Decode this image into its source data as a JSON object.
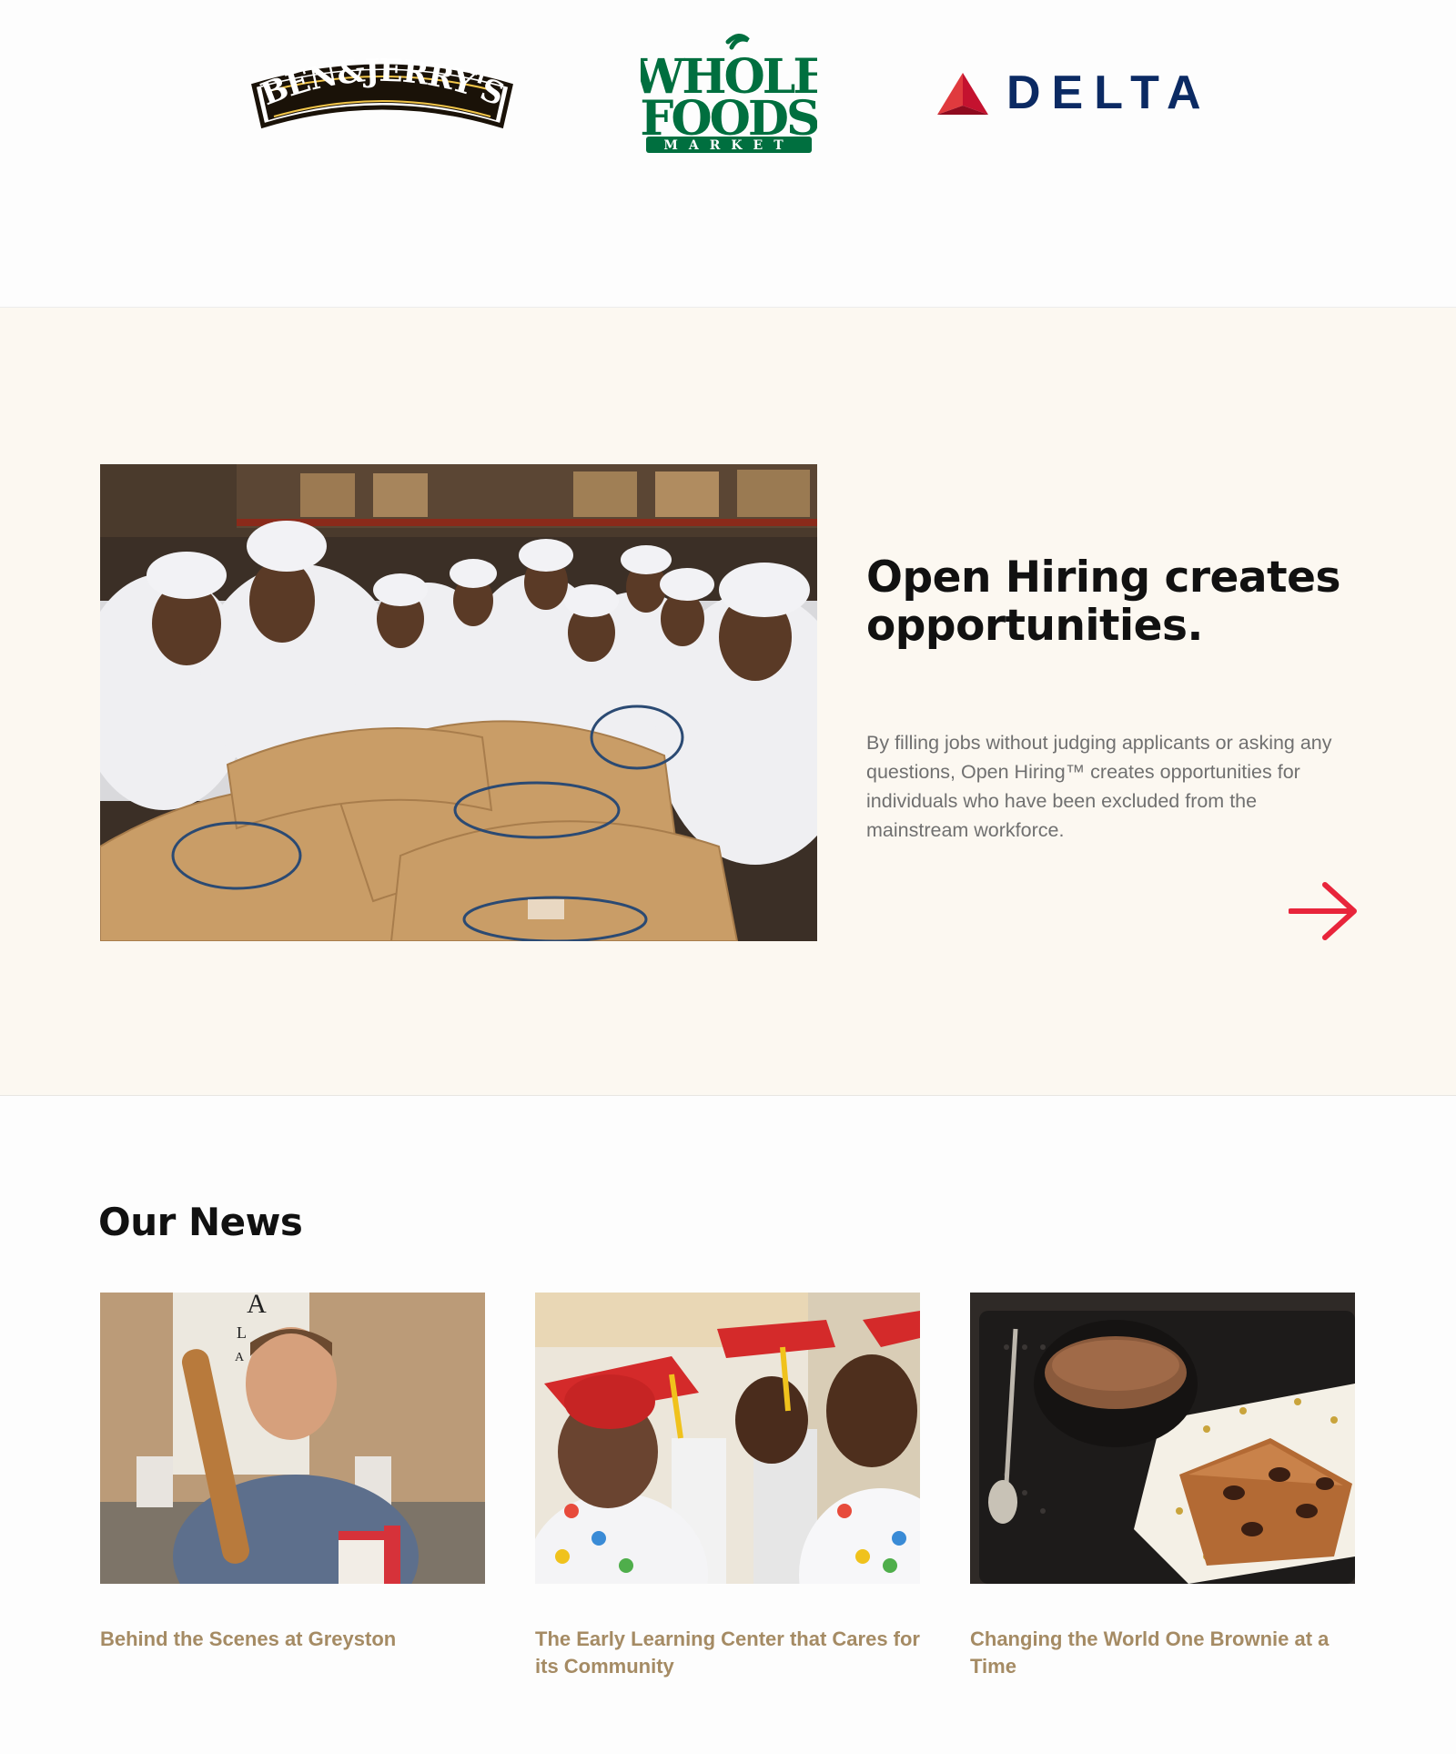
{
  "partners": {
    "ben_jerrys": {
      "icon": "ben-and-jerrys-logo-icon",
      "wordmark": "BEN&JERRY'S",
      "colors": {
        "dark": "#1a1208",
        "accent": "#f2c64a"
      }
    },
    "whole_foods": {
      "icon": "whole-foods-market-logo-icon",
      "line1": "WHOLE",
      "line2": "FOODS",
      "line3": "MARKET",
      "colors": {
        "green": "#006f3f"
      }
    },
    "delta": {
      "icon": "delta-logo-icon",
      "wordmark": "DELTA",
      "colors": {
        "navy": "#0b2a63",
        "red": "#c4122f"
      }
    }
  },
  "feature": {
    "title": "Open Hiring creates opportunities.",
    "body": "By filling jobs without judging applicants or asking any questions, Open Hiring™ creates opportunities for individuals who have been excluded from the mainstream workforce.",
    "photo_alt": "workers-in-hairnets-with-sugar-sacks",
    "arrow_icon": "arrow-right-icon",
    "colors": {
      "background": "#fcf8f1",
      "arrow": "#e8253b"
    }
  },
  "news": {
    "heading": "Our News",
    "items": [
      {
        "title": "Behind the Scenes at Greyston"
      },
      {
        "title": "The Early Learning Center that Cares for its Community"
      },
      {
        "title": "Changing the World One Brownie at a Time"
      }
    ],
    "colors": {
      "link": "#a58b64"
    }
  }
}
